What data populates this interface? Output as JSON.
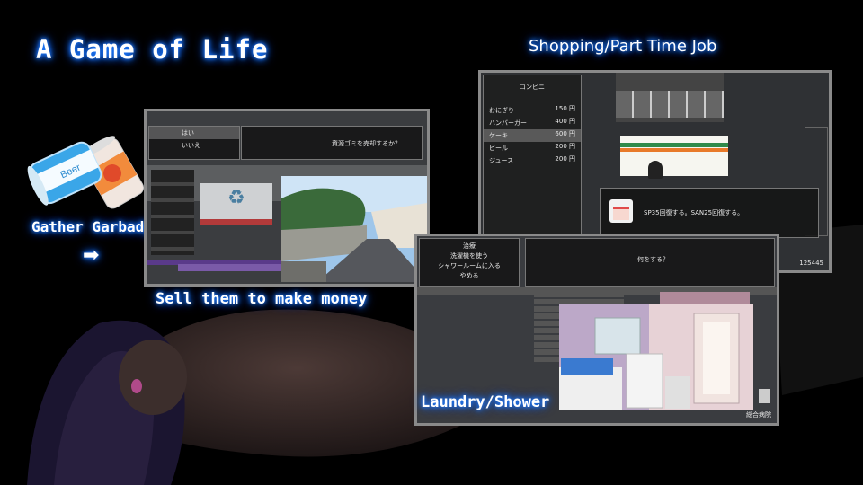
{
  "title": "A Game of Life",
  "captions": {
    "shopping": "Shopping/Part Time Job",
    "gather": "Gather Garbadge",
    "arrow": "➡",
    "sell": "Sell them to make money",
    "laundry": "Laundry/Shower"
  },
  "cans": {
    "beer_label": "Beer"
  },
  "win1": {
    "choices": [
      "はい",
      "いいえ"
    ],
    "prompt": "資源ゴミを売却するか？"
  },
  "win2": {
    "shop_name": "コンビニ",
    "items": [
      {
        "name": "おにぎり",
        "price": "150 円"
      },
      {
        "name": "ハンバーガー",
        "price": "400 円"
      },
      {
        "name": "ケーキ",
        "price": "600 円"
      },
      {
        "name": "ビール",
        "price": "200 円"
      },
      {
        "name": "ジュース",
        "price": "200 円"
      }
    ],
    "selected_index": 2,
    "description": "SP35回復する。SAN25回復する。",
    "money": "125445"
  },
  "win3": {
    "choices": [
      "治療",
      "洗濯機を使う",
      "シャワールームに入る",
      "やめる"
    ],
    "prompt": "何をする？",
    "location": "総合病院"
  },
  "colors": {
    "glow": "#1e7bff",
    "frame": "#8a8a8a"
  }
}
